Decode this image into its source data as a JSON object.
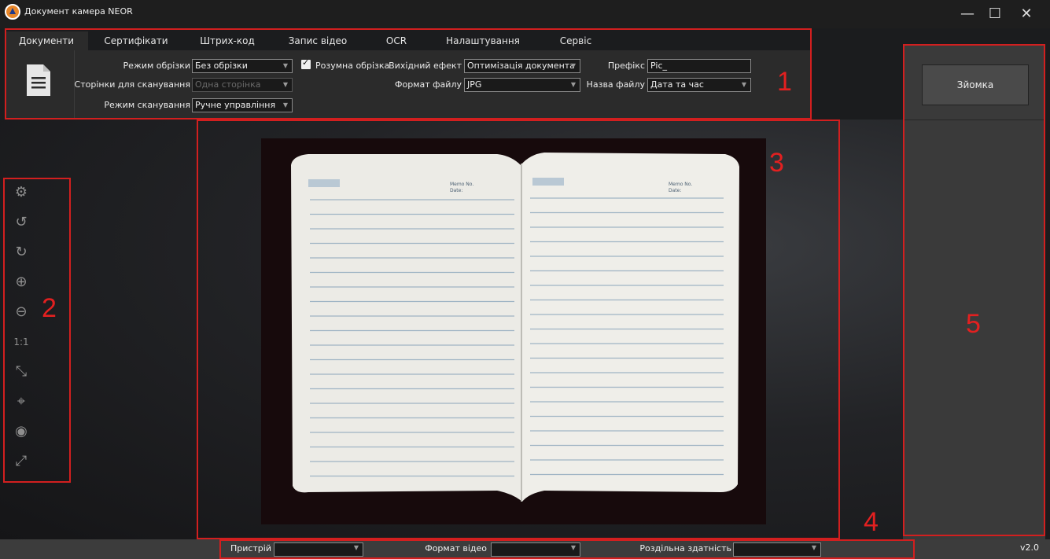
{
  "window": {
    "title": "Документ камера NEOR"
  },
  "tabs": [
    "Документи",
    "Сертифікати",
    "Штрих-код",
    "Запис відео",
    "OCR",
    "Налаштування",
    "Сервіс"
  ],
  "settings": {
    "crop_mode_label": "Режим обрізки",
    "crop_mode_value": "Без обрізки",
    "pages_label": "Сторінки для сканування",
    "pages_value": "Одна сторінка",
    "scan_mode_label": "Режим сканування",
    "scan_mode_value": "Ручне управління",
    "smart_crop_label": "Розумна обрізка",
    "smart_crop_checked": true,
    "output_effect_label": "Вихідний ефект",
    "output_effect_value": "Оптимізація документа",
    "file_format_label": "Формат файлу",
    "file_format_value": "JPG",
    "prefix_label": "Префікс",
    "prefix_value": "Pic_",
    "file_name_label": "Назва файлу",
    "file_name_value": "Дата та час"
  },
  "tools": [
    "gear-icon",
    "rotate-left-icon",
    "rotate-right-icon",
    "zoom-in-icon",
    "zoom-out-icon",
    "actual-size-icon",
    "fit-icon",
    "crosshair-icon",
    "webcam-icon",
    "fullscreen-icon"
  ],
  "tool_glyphs": [
    "⚙",
    "↺",
    "↻",
    "⊕",
    "⊖",
    "1:1",
    "⤡",
    "⌖",
    "◉",
    "⤢"
  ],
  "notebook": {
    "left_header": "Memo No.",
    "left_date": "Date:",
    "right_header": "Memo No.",
    "right_date": "Date:"
  },
  "right_panel": {
    "capture_label": "Зйомка"
  },
  "status": {
    "device_label": "Пристрій",
    "device_value": "",
    "video_format_label": "Формат відео",
    "video_format_value": "",
    "resolution_label": "Роздільна здатність",
    "resolution_value": "",
    "version": "v2.0"
  },
  "annotations": [
    "1",
    "2",
    "3",
    "4",
    "5"
  ],
  "colors": {
    "annotation": "#d21f1f",
    "panel": "#2b2b2b",
    "background": "#1b1c1e"
  }
}
